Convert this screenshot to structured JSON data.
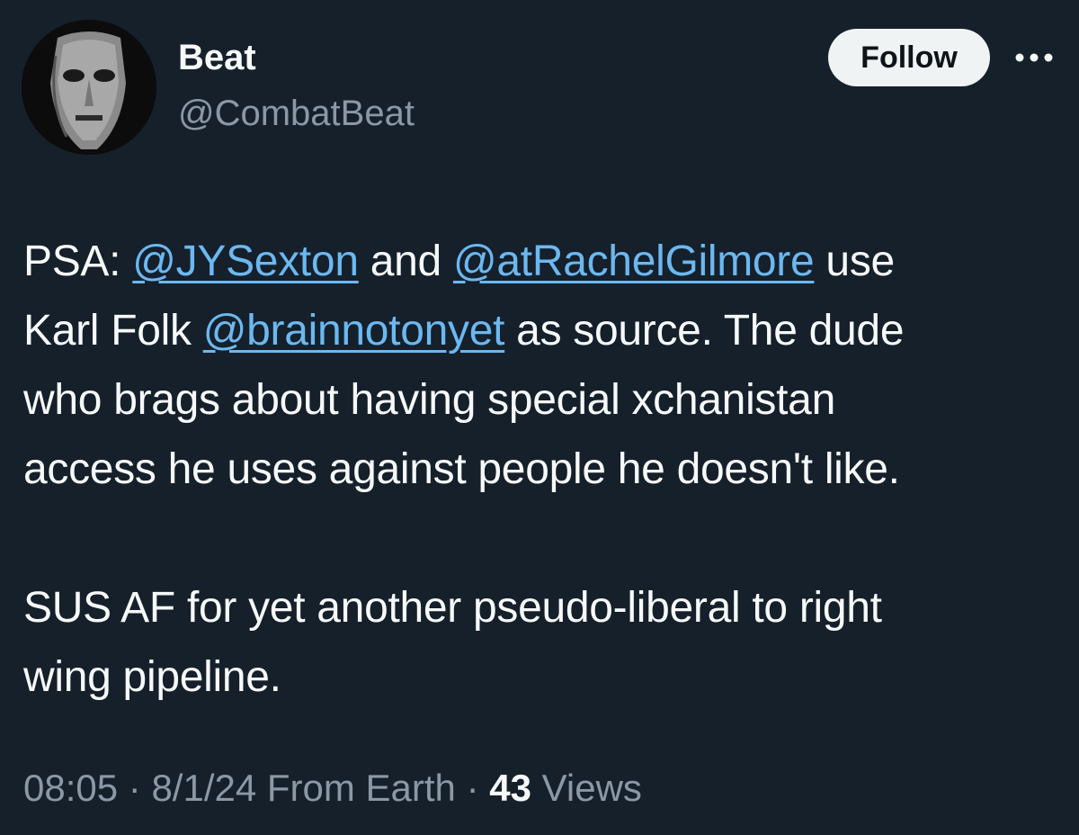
{
  "author": {
    "display_name": "Beat",
    "handle": "@CombatBeat",
    "avatar_icon": "mask-avatar"
  },
  "actions": {
    "follow_label": "Follow",
    "more_icon": "more-horizontal-icon"
  },
  "tweet": {
    "lines": [
      [
        {
          "text": "PSA: "
        },
        {
          "text": "@JYSexton",
          "mention": true
        },
        {
          "text": " and "
        },
        {
          "text": "@atRachelGilmore",
          "mention": true
        },
        {
          "text": " use"
        }
      ],
      [
        {
          "text": "Karl Folk "
        },
        {
          "text": "@brainnotonyet",
          "mention": true
        },
        {
          "text": " as source. The dude"
        }
      ],
      [
        {
          "text": "who brags about having special xchanistan"
        }
      ],
      [
        {
          "text": "access he uses against people he doesn't like."
        }
      ],
      [],
      [
        {
          "text": "SUS AF for yet another pseudo-liberal to right"
        }
      ],
      [
        {
          "text": "wing pipeline."
        }
      ]
    ]
  },
  "meta": {
    "time": "08:05",
    "separator": " · ",
    "date_location": "8/1/24 From Earth",
    "views_count": "43",
    "views_label": " Views"
  },
  "colors": {
    "background": "#15202b",
    "text": "#f7f9f9",
    "secondary": "#8b98a5",
    "link": "#6cb8f0",
    "follow_bg": "#eff3f4"
  }
}
